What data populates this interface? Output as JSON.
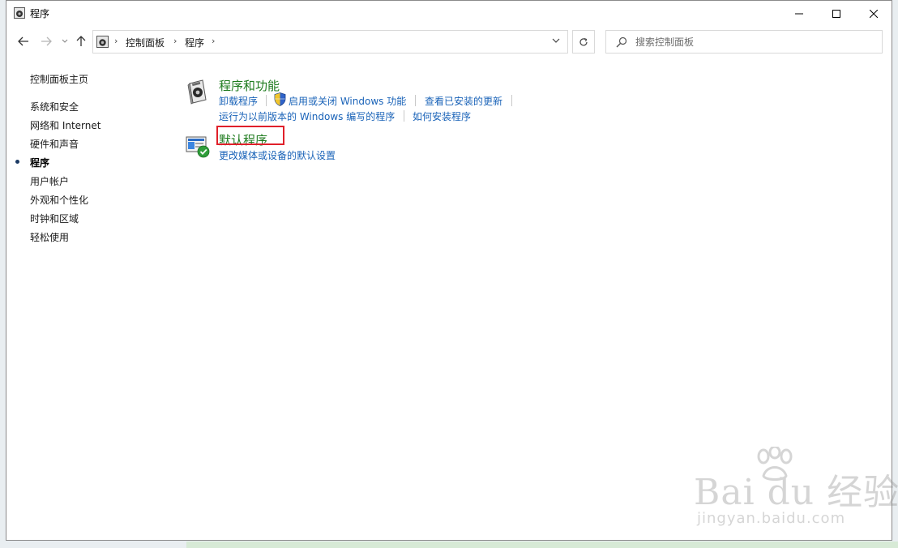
{
  "window": {
    "title": "程序"
  },
  "address": {
    "breadcrumbs": [
      "控制面板",
      "程序"
    ],
    "search_placeholder": "搜索控制面板"
  },
  "sidebar": {
    "home": "控制面板主页",
    "items": [
      {
        "label": "系统和安全",
        "active": false
      },
      {
        "label": "网络和 Internet",
        "active": false
      },
      {
        "label": "硬件和声音",
        "active": false
      },
      {
        "label": "程序",
        "active": true
      },
      {
        "label": "用户帐户",
        "active": false
      },
      {
        "label": "外观和个性化",
        "active": false
      },
      {
        "label": "时钟和区域",
        "active": false
      },
      {
        "label": "轻松使用",
        "active": false
      }
    ]
  },
  "categories": [
    {
      "title": "程序和功能",
      "links": [
        "卸载程序",
        "启用或关闭 Windows 功能",
        "查看已安装的更新",
        "运行为以前版本的 Windows 编写的程序",
        "如何安装程序"
      ]
    },
    {
      "title": "默认程序",
      "links": [
        "更改媒体或设备的默认设置"
      ],
      "highlighted": true
    }
  ],
  "watermark": {
    "brand": "Bai du 经验",
    "url": "jingyan.baidu.com"
  },
  "colors": {
    "link": "#1a63b8",
    "category_title": "#1e7b1e",
    "highlight": "#e0202a"
  }
}
